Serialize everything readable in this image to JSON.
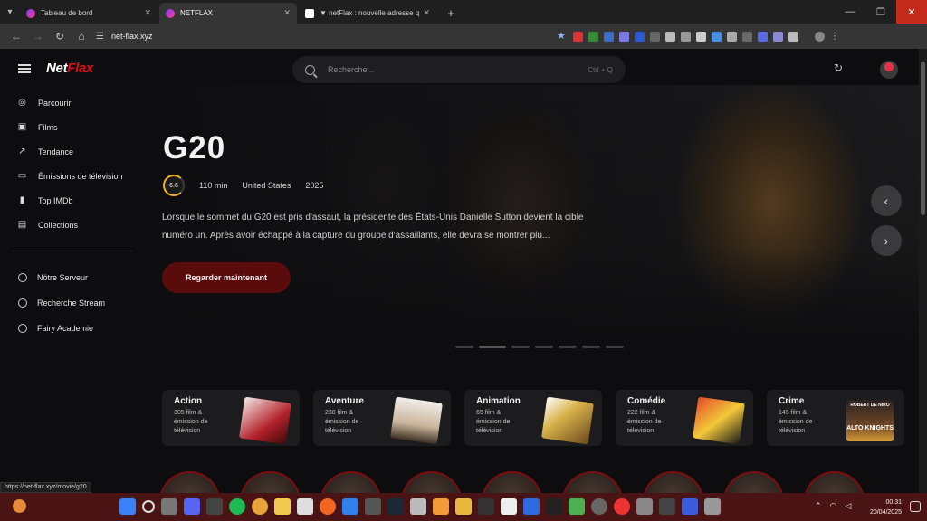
{
  "browser": {
    "tabs": [
      {
        "title": "Tableau de bord",
        "active": false
      },
      {
        "title": "NETFLAX",
        "active": true
      },
      {
        "title": "▼ netFlax : nouvelle adresse qu",
        "active": false
      }
    ],
    "url": "net-flax.xyz",
    "status_url": "https://net-flax.xyz/movie/g20"
  },
  "app": {
    "logo": {
      "part1": "Net",
      "part2": "Flax"
    },
    "search": {
      "placeholder": "Recherche ..",
      "shortcut": "Ctrl + Q"
    }
  },
  "sidebar": {
    "items": [
      {
        "label": "Parcourir",
        "icon": "compass-icon"
      },
      {
        "label": "Films",
        "icon": "film-icon"
      },
      {
        "label": "Tendance",
        "icon": "trending-icon"
      },
      {
        "label": "Émissions de télévision",
        "icon": "tv-icon"
      },
      {
        "label": "Top IMDb",
        "icon": "bar-chart-icon"
      },
      {
        "label": "Collections",
        "icon": "collections-icon"
      }
    ],
    "servers": [
      {
        "label": "Nötre Serveur"
      },
      {
        "label": "Recherche Stream"
      },
      {
        "label": "Fairy Academie"
      }
    ]
  },
  "hero": {
    "title": "G20",
    "rating": "6.6",
    "duration": "110 min",
    "country": "United States",
    "year": "2025",
    "description": "Lorsque le sommet du G20 est pris d'assaut, la présidente des États-Unis Danielle Sutton devient la cible numéro un. Après avoir échappé à la capture du groupe d'assaillants, elle devra se montrer plu...",
    "watch_label": "Regarder maintenant",
    "slide_count": 7,
    "active_slide": 1
  },
  "genres": [
    {
      "name": "Action",
      "count": "305 film & émission de télévision"
    },
    {
      "name": "Aventure",
      "count": "238 film & émission de télévision"
    },
    {
      "name": "Animation",
      "count": "65 film & émission de télévision"
    },
    {
      "name": "Comédie",
      "count": "222 film & émission de télévision"
    },
    {
      "name": "Crime",
      "count": "145 film & émission de télévision",
      "poster_top": "ROBERT DE NIRO",
      "poster_title": "ALTO KNIGHTS"
    }
  ],
  "taskbar": {
    "time": "00:31",
    "date": "20/04/2025"
  },
  "colors": {
    "brand_red": "#e50914",
    "accent_dark_red": "#5a0b0b",
    "rating_gold": "#f0b429"
  }
}
